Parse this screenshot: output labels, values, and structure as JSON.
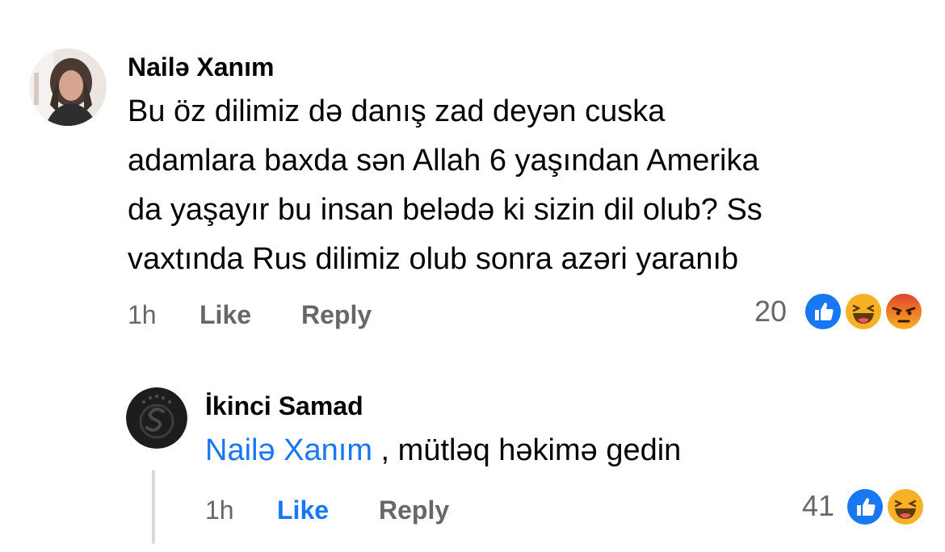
{
  "comment": {
    "author": "Nailə Xanım",
    "text_lines": [
      "Bu öz dilimiz də danış zad deyən cuska",
      "adamlara baxda sən Allah 6 yaşından Amerika",
      "da yaşayır bu insan belədə ki sizin dil olub? Ss",
      "vaxtında Rus dilimiz olub sonra azəri yaranıb"
    ],
    "time": "1h",
    "like_label": "Like",
    "reply_label": "Reply",
    "reaction_count": "20",
    "reactions": [
      "like-icon",
      "haha-icon",
      "angry-icon"
    ]
  },
  "reply": {
    "author": "İkinci Samad",
    "mention": "Nailə Xanım",
    "text": " , mütləq həkimə gedin",
    "time": "1h",
    "like_label": "Like",
    "reply_label": "Reply",
    "reaction_count": "41",
    "reactions": [
      "like-icon",
      "haha-icon"
    ]
  },
  "colors": {
    "link_blue": "#1877f2",
    "meta_gray": "#65676b",
    "like_reaction": "#1877f2",
    "haha_reaction": "#f7b125",
    "angry_reaction": "#e9710f"
  }
}
